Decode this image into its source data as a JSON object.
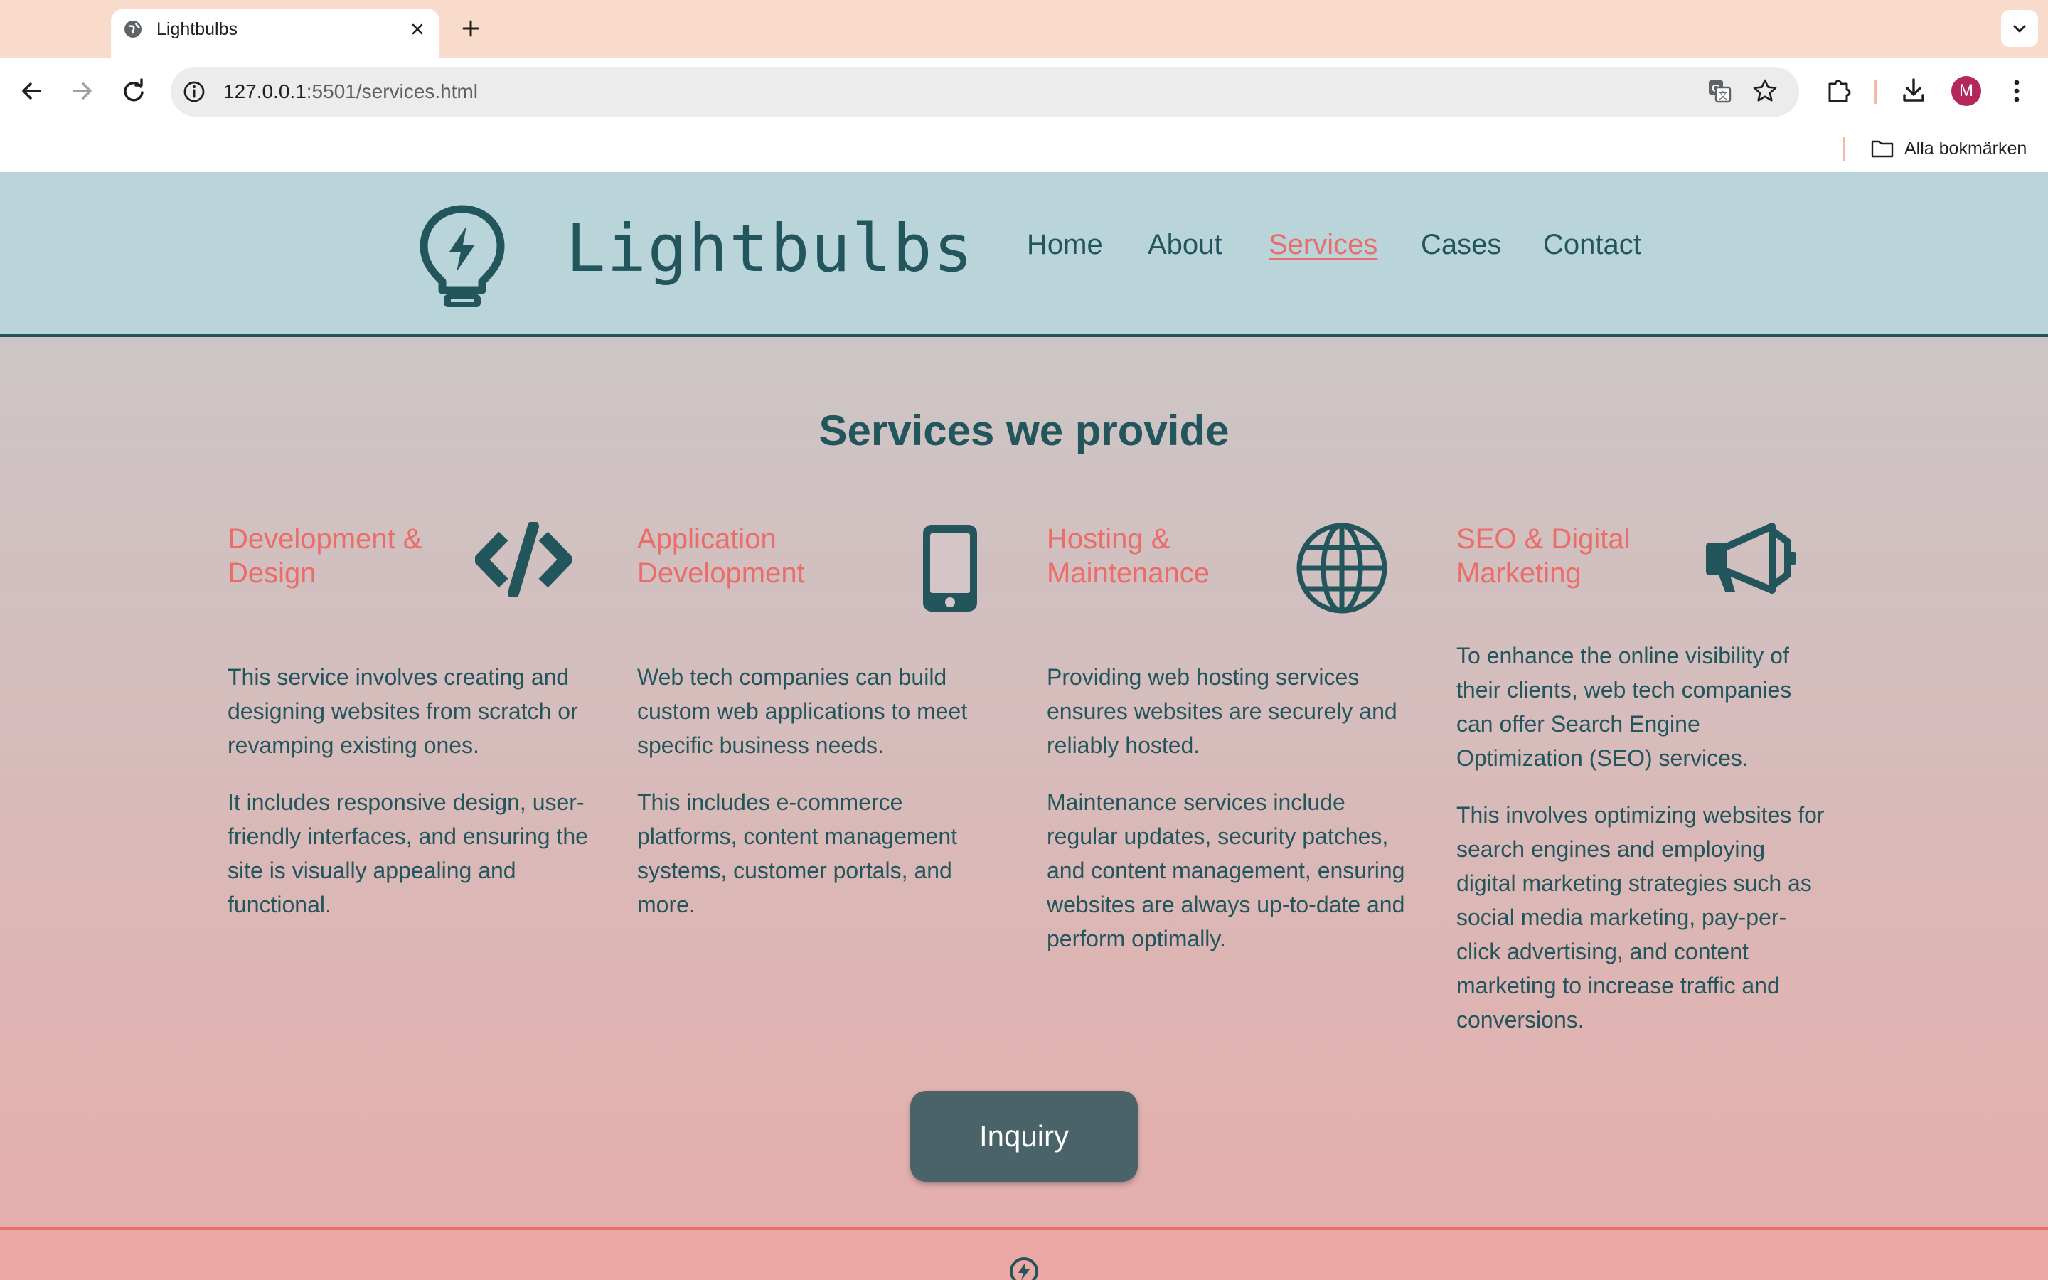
{
  "browser": {
    "tab_title": "Lightbulbs",
    "url_host": "127.0.0.1",
    "url_rest": ":5501/services.html",
    "avatar_letter": "M",
    "bookmarks_label": "Alla bokmärken"
  },
  "site": {
    "logo_text": "Lightbulbs",
    "nav": {
      "home": "Home",
      "about": "About",
      "services": "Services",
      "cases": "Cases",
      "contact": "Contact"
    },
    "active_nav": "Services"
  },
  "main": {
    "title": "Services we provide",
    "services": [
      {
        "title_line1": "Development &",
        "title_line2": "Design",
        "icon": "code-icon",
        "p1": "This service involves creating and designing websites from scratch or revamping existing ones.",
        "p2": "It includes responsive design, user-friendly interfaces, and ensuring the site is visually appealing and functional."
      },
      {
        "title_line1": "Application",
        "title_line2": "Development",
        "icon": "mobile-phone-icon",
        "p1": "Web tech companies can build custom web applications to meet specific business needs.",
        "p2": "This includes e-commerce platforms, content management systems, customer portals, and more."
      },
      {
        "title_line1": "Hosting &",
        "title_line2": "Maintenance",
        "icon": "globe-icon",
        "p1": "Providing web hosting services ensures websites are securely and reliably hosted.",
        "p2": "Maintenance services include regular updates, security patches, and content management, ensuring websites are always up-to-date and perform optimally."
      },
      {
        "title_line1": "SEO & Digital",
        "title_line2": "Marketing",
        "icon": "megaphone-icon",
        "p1": "To enhance the online visibility of their clients, web tech companies can offer Search Engine Optimization (SEO) services.",
        "p2": "This involves optimizing websites for search engines and employing digital marketing strategies such as social media marketing, pay-per-click advertising, and content marketing to increase traffic and conversions."
      }
    ],
    "inquiry_label": "Inquiry"
  },
  "colors": {
    "header_bg": "#b9d5d9",
    "primary_text": "#23555c",
    "accent": "#ea6d6a",
    "button_bg": "#4a6368"
  }
}
